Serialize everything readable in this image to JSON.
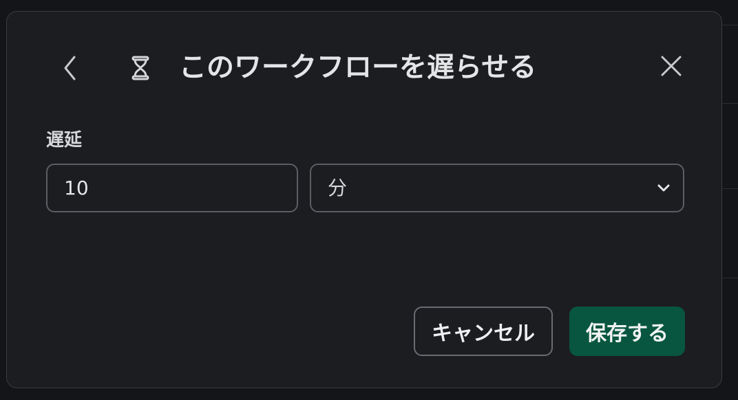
{
  "dialog": {
    "title": "このワークフローを遅らせる",
    "header_icon": "hourglass-icon",
    "back_icon": "chevron-left-icon",
    "close_icon": "close-icon"
  },
  "delay": {
    "label": "遅延",
    "amount_value": "10",
    "unit_selected": "分",
    "unit_dropdown_icon": "chevron-down-icon"
  },
  "actions": {
    "cancel_label": "キャンセル",
    "save_label": "保存する"
  },
  "colors": {
    "modal_bg": "#1c1d21",
    "page_bg": "#141518",
    "primary": "#08563f",
    "text": "#e4e5e7",
    "border": "#5c5e63"
  }
}
